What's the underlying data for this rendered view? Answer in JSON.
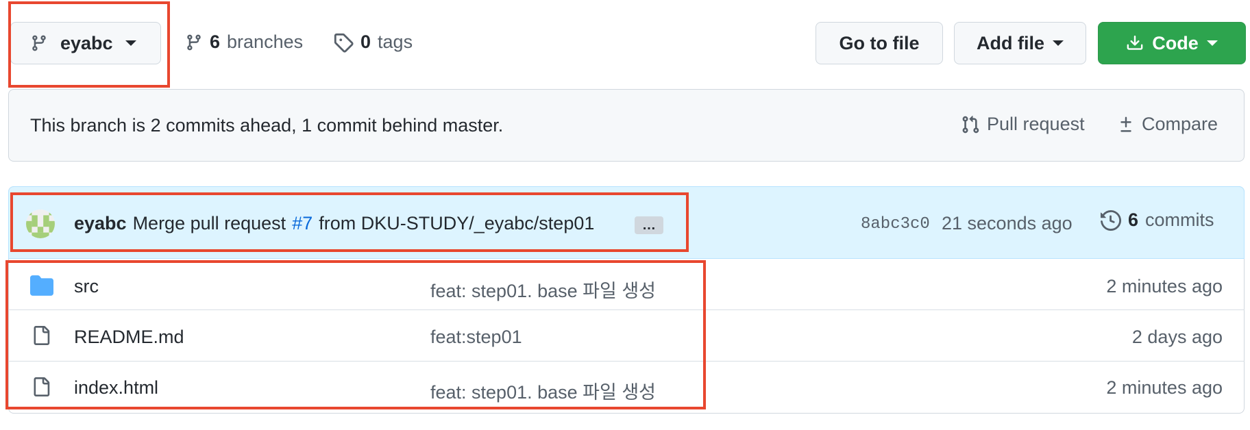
{
  "branch": {
    "name": "eyabc"
  },
  "stats": {
    "branches_count": "6",
    "branches_label": "branches",
    "tags_count": "0",
    "tags_label": "tags"
  },
  "toolbar": {
    "go_to_file": "Go to file",
    "add_file": "Add file",
    "code": "Code"
  },
  "compare": {
    "status_text": "This branch is 2 commits ahead, 1 commit behind master.",
    "pull_request": "Pull request",
    "compare_label": "Compare"
  },
  "latest_commit": {
    "author": "eyabc",
    "message_prefix": "Merge pull request",
    "pr_link": "#7",
    "message_suffix": "from DKU-STUDY/_eyabc/step01",
    "ellipsis": "…",
    "sha": "8abc3c0",
    "time": "21 seconds ago",
    "commits_count": "6",
    "commits_label": "commits"
  },
  "files": [
    {
      "type": "folder",
      "name": "src",
      "message": "feat: step01. base 파일 생성",
      "age": "2 minutes ago"
    },
    {
      "type": "file",
      "name": "README.md",
      "message": "feat:step01",
      "age": "2 days ago"
    },
    {
      "type": "file",
      "name": "index.html",
      "message": "feat: step01. base 파일 생성",
      "age": "2 minutes ago"
    }
  ],
  "colors": {
    "accent_green": "#2da44e",
    "link_blue": "#0969da",
    "annotation_red": "#e8472f",
    "folder_blue": "#54aeff"
  }
}
